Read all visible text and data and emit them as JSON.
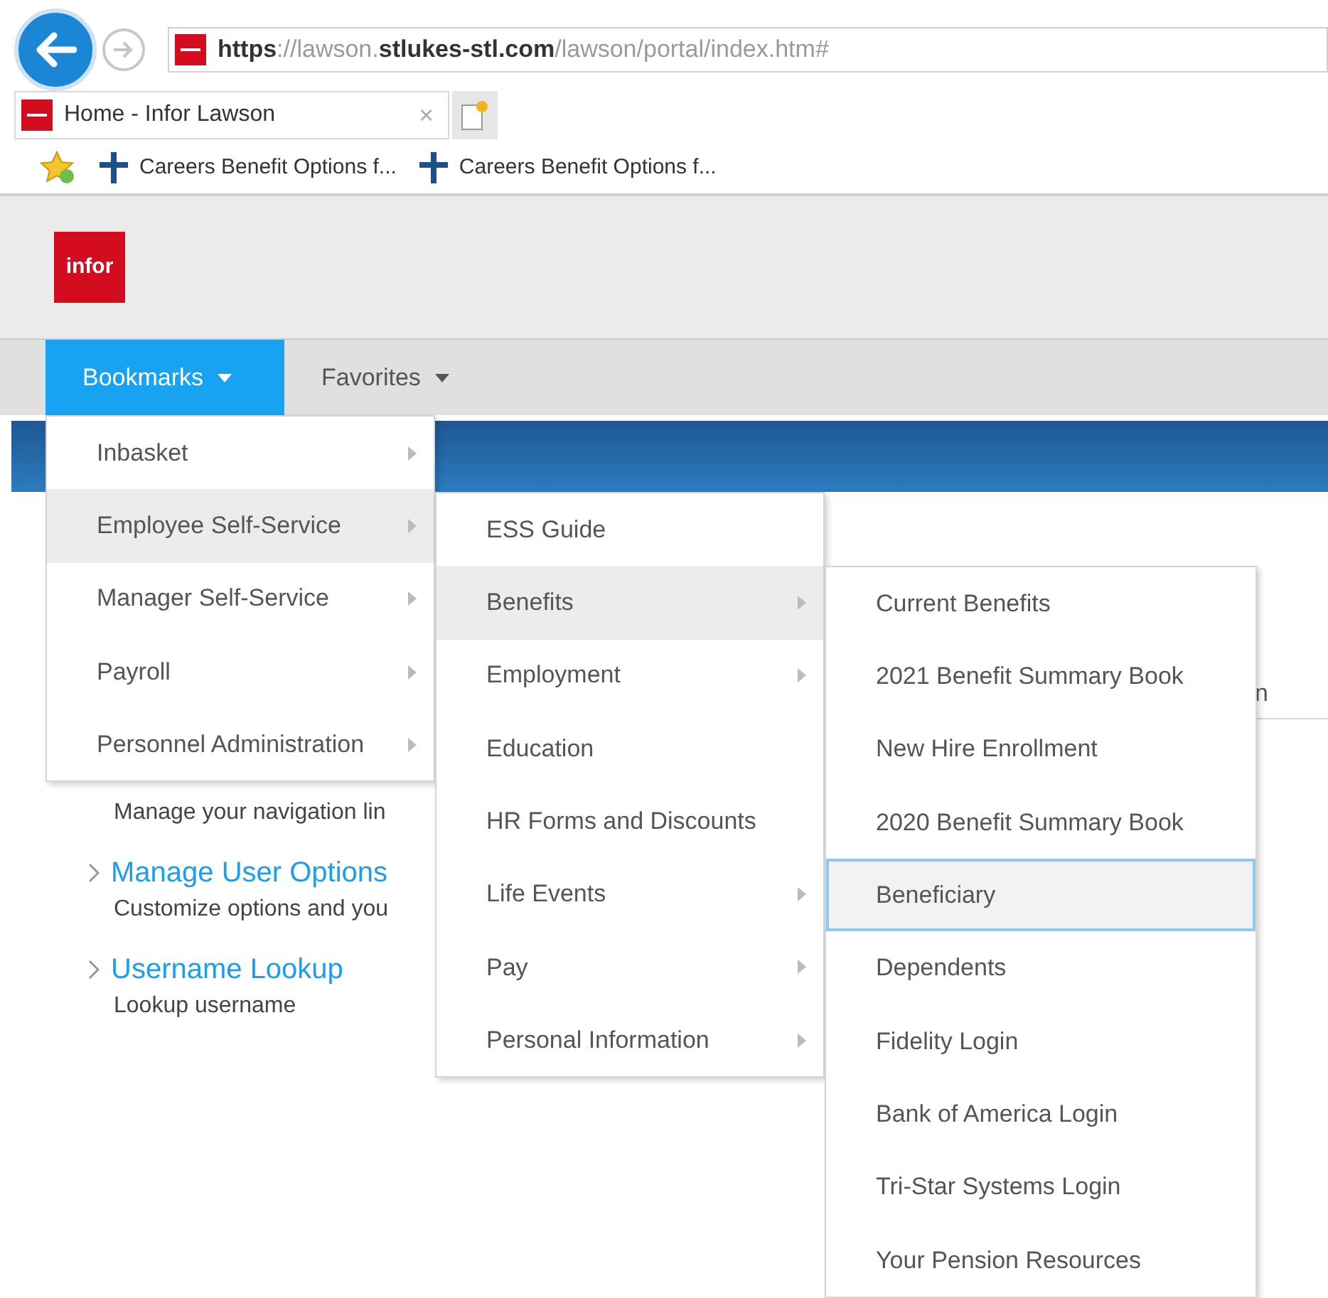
{
  "browser": {
    "url": "**https**://lawson.**stlukes-stl.com**/lawson/portal/index.htm#",
    "tab": {
      "title": "Home - Infor Lawson",
      "close": "×"
    },
    "bookmarks_bar": [
      {
        "title": "Careers Benefit Options f..."
      },
      {
        "title": "Careers Benefit Options f..."
      }
    ]
  },
  "header": {
    "logo": "infor"
  },
  "nav": [
    {
      "label": "Bookmarks",
      "selected": true
    },
    {
      "label": "Favorites",
      "selected": false
    }
  ],
  "content": {
    "items": [
      {
        "description": "Manage your navigation lin"
      },
      {
        "title": "Manage User Options",
        "description": "Customize options and you"
      },
      {
        "title": "Username Lookup",
        "description": "Lookup username"
      }
    ],
    "cut_text": "n"
  },
  "menus": [
    {
      "kind": "branch",
      "items": [
        {
          "label": "Inbasket",
          "has_submenu": true,
          "selected": false
        },
        {
          "label": "Employee Self-Service",
          "has_submenu": true,
          "selected": true
        },
        {
          "label": "Manager Self-Service",
          "has_submenu": true,
          "selected": false
        },
        {
          "label": "Payroll",
          "has_submenu": true,
          "selected": false
        },
        {
          "label": "Personnel Administration",
          "has_submenu": true,
          "selected": false
        }
      ]
    },
    {
      "kind": "branch",
      "items": [
        {
          "label": "ESS Guide",
          "has_submenu": false,
          "selected": false
        },
        {
          "label": "Benefits",
          "has_submenu": true,
          "selected": true
        },
        {
          "label": "Employment",
          "has_submenu": true,
          "selected": false
        },
        {
          "label": "Education",
          "has_submenu": false,
          "selected": false
        },
        {
          "label": "HR Forms and Discounts",
          "has_submenu": false,
          "selected": false
        },
        {
          "label": "Life Events",
          "has_submenu": true,
          "selected": false
        },
        {
          "label": "Pay",
          "has_submenu": true,
          "selected": false
        },
        {
          "label": "Personal Information",
          "has_submenu": true,
          "selected": false
        }
      ]
    },
    {
      "kind": "leaf",
      "items": [
        {
          "label": "Current Benefits",
          "has_submenu": false,
          "selected": false
        },
        {
          "label": "2021 Benefit Summary Book",
          "has_submenu": false,
          "selected": false
        },
        {
          "label": "New Hire Enrollment",
          "has_submenu": false,
          "selected": false
        },
        {
          "label": "2020 Benefit Summary Book",
          "has_submenu": false,
          "selected": false
        },
        {
          "label": "Beneficiary",
          "has_submenu": false,
          "selected": true
        },
        {
          "label": "Dependents",
          "has_submenu": false,
          "selected": false
        },
        {
          "label": "Fidelity Login",
          "has_submenu": false,
          "selected": false
        },
        {
          "label": "Bank of America Login",
          "has_submenu": false,
          "selected": false
        },
        {
          "label": "Tri-Star Systems Login",
          "has_submenu": false,
          "selected": false
        },
        {
          "label": "Your Pension Resources",
          "has_submenu": false,
          "selected": false
        }
      ]
    }
  ]
}
